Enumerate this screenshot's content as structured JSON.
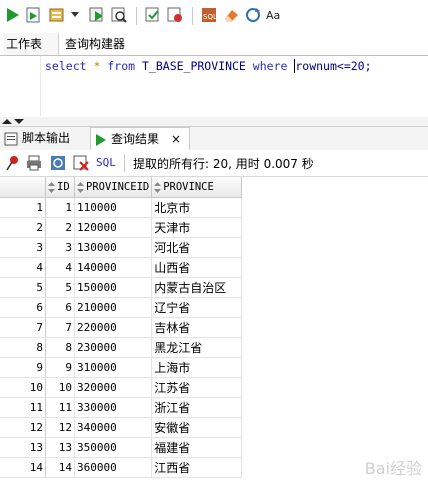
{
  "editor": {
    "tabs": [
      "工作表",
      "查询构建器"
    ],
    "code": {
      "kw_select": "select",
      "star": "*",
      "kw_from": "from",
      "table": "T_BASE_PROVINCE",
      "kw_where": "where",
      "condition": "rownum<=",
      "limit": "20",
      "end": ";"
    }
  },
  "output_tabs": {
    "script_output": "脚本输出",
    "query_result": "查询结果",
    "close": "×"
  },
  "result_toolbar": {
    "sql_label": "SQL",
    "status": "提取的所有行: 20, 用时 0.007 秒"
  },
  "grid": {
    "columns": [
      "ID",
      "PROVINCEID",
      "PROVINCE"
    ],
    "rows": [
      [
        "1",
        "1",
        "110000",
        "北京市"
      ],
      [
        "2",
        "2",
        "120000",
        "天津市"
      ],
      [
        "3",
        "3",
        "130000",
        "河北省"
      ],
      [
        "4",
        "4",
        "140000",
        "山西省"
      ],
      [
        "5",
        "5",
        "150000",
        "内蒙古自治区"
      ],
      [
        "6",
        "6",
        "210000",
        "辽宁省"
      ],
      [
        "7",
        "7",
        "220000",
        "吉林省"
      ],
      [
        "8",
        "8",
        "230000",
        "黑龙江省"
      ],
      [
        "9",
        "9",
        "310000",
        "上海市"
      ],
      [
        "10",
        "10",
        "320000",
        "江苏省"
      ],
      [
        "11",
        "11",
        "330000",
        "浙江省"
      ],
      [
        "12",
        "12",
        "340000",
        "安徽省"
      ],
      [
        "13",
        "13",
        "350000",
        "福建省"
      ],
      [
        "14",
        "14",
        "360000",
        "江西省"
      ]
    ]
  },
  "watermark": "Bai经验"
}
